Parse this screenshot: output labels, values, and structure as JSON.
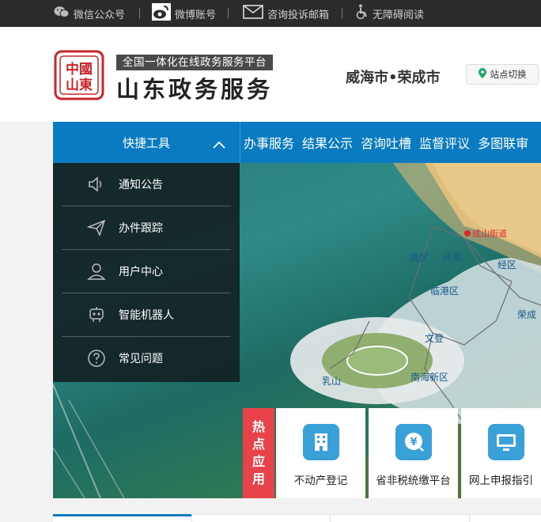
{
  "topbar": {
    "wechat": "微信公众号",
    "weibo": "微博账号",
    "mail": "咨询投诉邮箱",
    "accessibility": "无障碍阅读"
  },
  "header": {
    "slogan": "全国一体化在线政务服务平台",
    "title": "山东政务服务",
    "region": "威海市•荣成市",
    "switch_label": "站点切换",
    "seal_text": "中国山东"
  },
  "nav": {
    "quick_tools": "快捷工具",
    "items": [
      "办事服务",
      "结果公示",
      "咨询吐槽",
      "监督评议",
      "多图联审"
    ]
  },
  "quick_menu": [
    {
      "label": "通知公告",
      "icon": "speaker-icon"
    },
    {
      "label": "办件跟踪",
      "icon": "paper-plane-icon"
    },
    {
      "label": "用户中心",
      "icon": "user-icon"
    },
    {
      "label": "智能机器人",
      "icon": "robot-icon"
    },
    {
      "label": "常见问题",
      "icon": "question-icon"
    }
  ],
  "map_labels": {
    "center": "成山街道",
    "a": "高区",
    "b": "环翠",
    "c": "经区",
    "d": "临港区",
    "e": "荣成",
    "f": "文登",
    "g": "乳山",
    "h": "南海新区"
  },
  "hot_apps": {
    "tag": [
      "热",
      "点",
      "应",
      "用"
    ],
    "items": [
      {
        "label": "不动产登记",
        "icon": "building-icon"
      },
      {
        "label": "省非税统缴平台",
        "icon": "yuan-icon"
      },
      {
        "label": "网上申报指引",
        "icon": "monitor-icon"
      }
    ]
  },
  "colors": {
    "primary": "#0a7bc1",
    "hot": "#e8434a",
    "topbar": "#2b2b2b"
  }
}
